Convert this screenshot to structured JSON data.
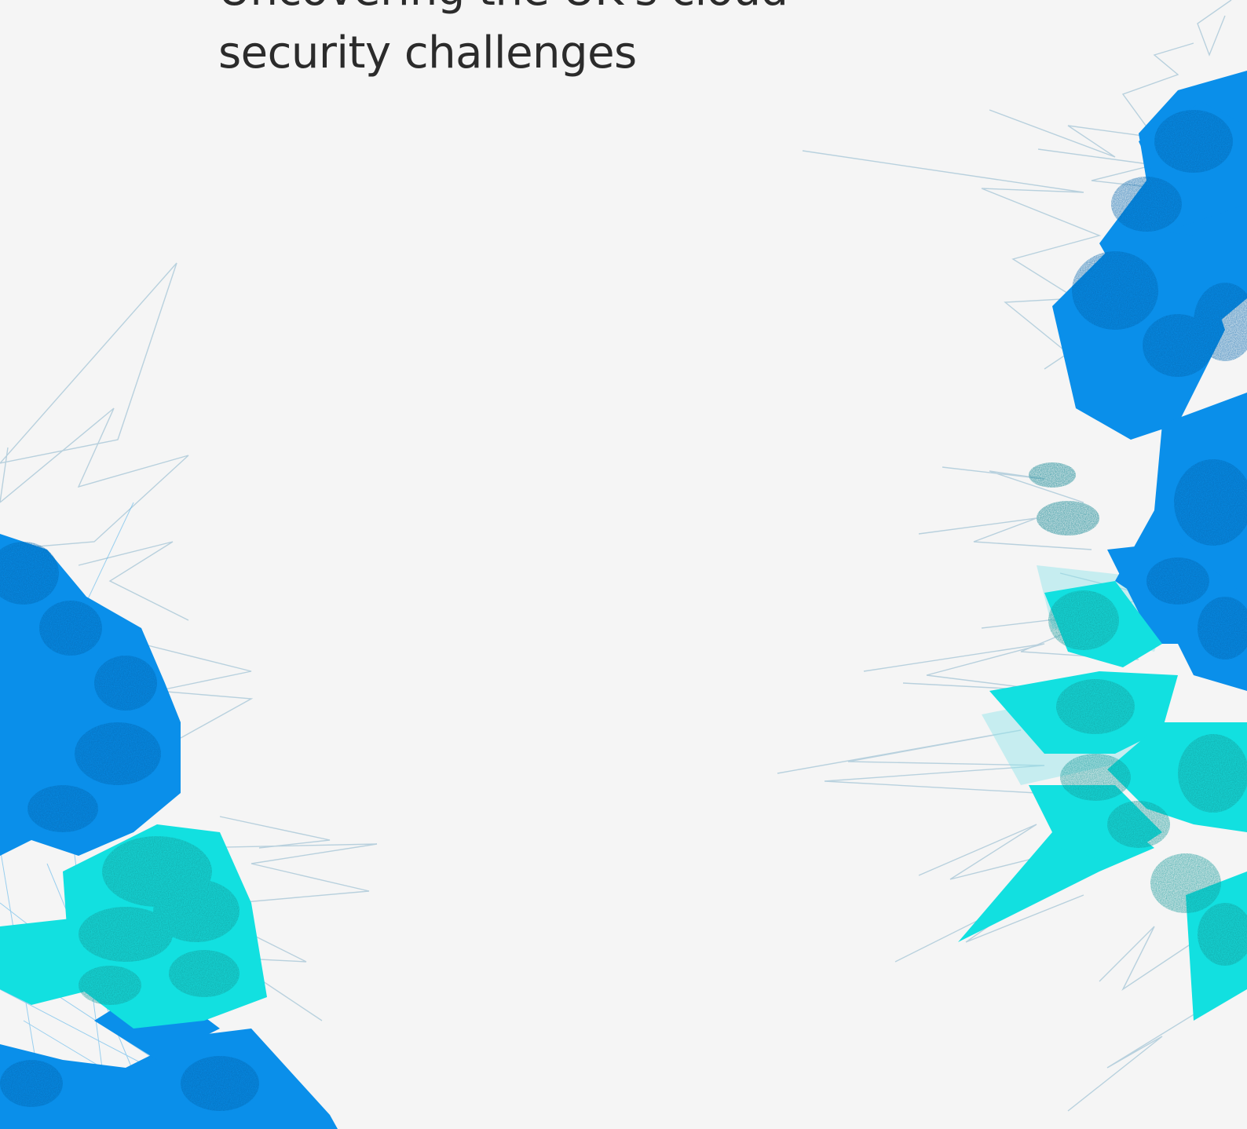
{
  "cover": {
    "title_line_1": "Uncovering the UK's cloud",
    "title_line_2": "security challenges"
  },
  "colors": {
    "background": "#f5f5f5",
    "text": "#2b2b2b",
    "blue": "#0a8fea",
    "dark_blue": "#0a64ad",
    "cyan": "#12e0e0",
    "teal": "#159a9a",
    "line": "#9fc4d6"
  },
  "artwork": {
    "name": "abstract-network-splash"
  }
}
